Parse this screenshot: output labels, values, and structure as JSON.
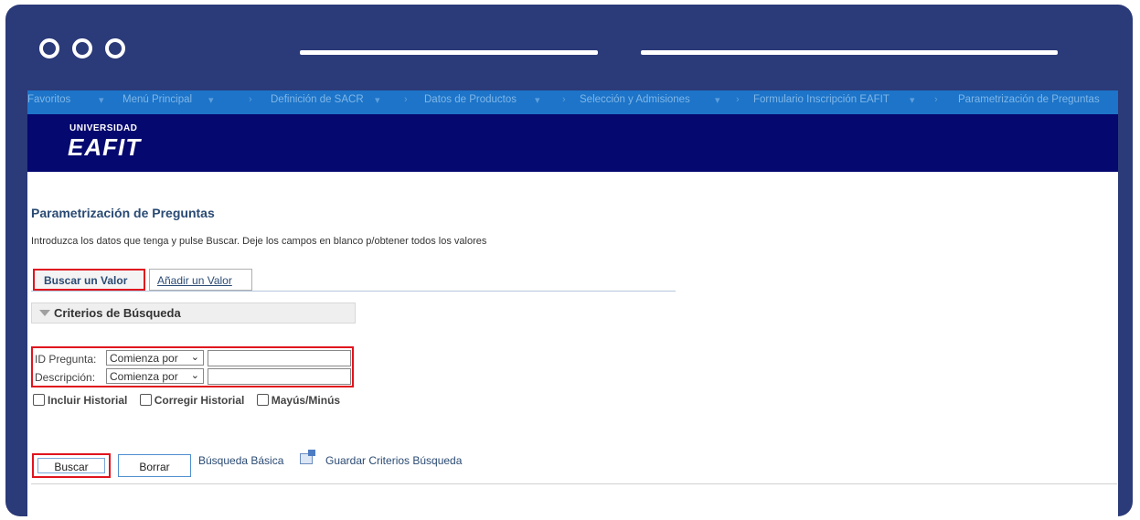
{
  "menu": [
    "Favoritos",
    "Menú Principal",
    "Definición de SACR",
    "Datos de Productos",
    "Selección y Admisiones",
    "Formulario Inscripción EAFIT",
    "Parametrización de Preguntas"
  ],
  "logo": {
    "top": "UNIVERSIDAD",
    "main": "EAFIT"
  },
  "page": {
    "title": "Parametrización de Preguntas",
    "instructions": "Introduzca los datos que tenga y pulse Buscar. Deje los campos en blanco p/obtener todos los valores"
  },
  "tabs": {
    "search": "Buscar un Valor",
    "add": "Añadir un Valor"
  },
  "criteria": {
    "title": "Criterios de Búsqueda"
  },
  "fields": [
    {
      "label": "ID Pregunta:",
      "operator": "Comienza por",
      "value": ""
    },
    {
      "label": "Descripción:",
      "operator": "Comienza por",
      "value": ""
    }
  ],
  "checkboxes": [
    "Incluir Historial",
    "Corregir Historial",
    "Mayús/Minús"
  ],
  "buttons": {
    "search": "Buscar",
    "clear": "Borrar"
  },
  "links": {
    "basic": "Búsqueda Básica",
    "save": "Guardar Criterios Búsqueda"
  },
  "colors": {
    "frame": "#2b3a78",
    "menu": "#1d74c8",
    "banner": "#05086e",
    "highlight": "#e0141e"
  }
}
